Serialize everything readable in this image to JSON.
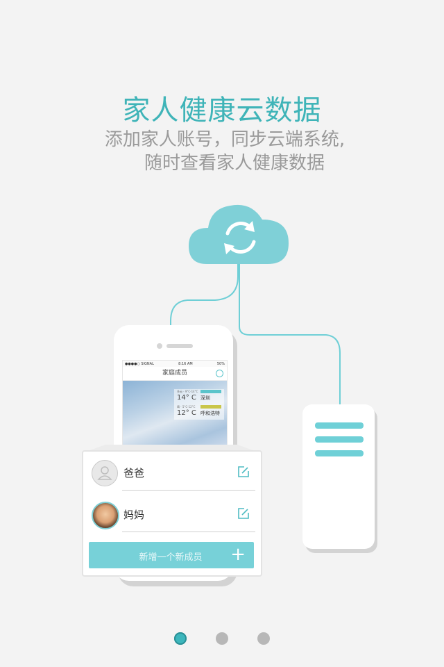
{
  "header": {
    "title": "家人健康云数据",
    "subtitle_line1": "添加家人账号，同步云端系统,",
    "subtitle_line2": "随时查看家人健康数据"
  },
  "phone": {
    "status": {
      "carrier": "●●●●○ SIGNAL",
      "time": "8:16 AM",
      "battery": "50%"
    },
    "nav_title": "家庭成员",
    "weather": [
      {
        "small": "多云 · 9°C-14°C",
        "temp": "14° C",
        "city": "深圳"
      },
      {
        "small": "晴 · 5°C-12°C",
        "temp": "12° C",
        "city": "呼和浩特"
      }
    ]
  },
  "members": [
    {
      "name": "爸爸",
      "avatar": "default-avatar-icon"
    },
    {
      "name": "妈妈",
      "avatar": "photo-avatar"
    }
  ],
  "add_button": {
    "label": "新增一个新成员",
    "icon": "plus-icon"
  },
  "pagination": {
    "current": 1,
    "total": 3
  },
  "colors": {
    "accent": "#3fb4b8",
    "cloud": "#7fd0d7",
    "button": "#77d1d8",
    "subtitle": "#9a9a9a",
    "background": "#f3f3f3"
  }
}
